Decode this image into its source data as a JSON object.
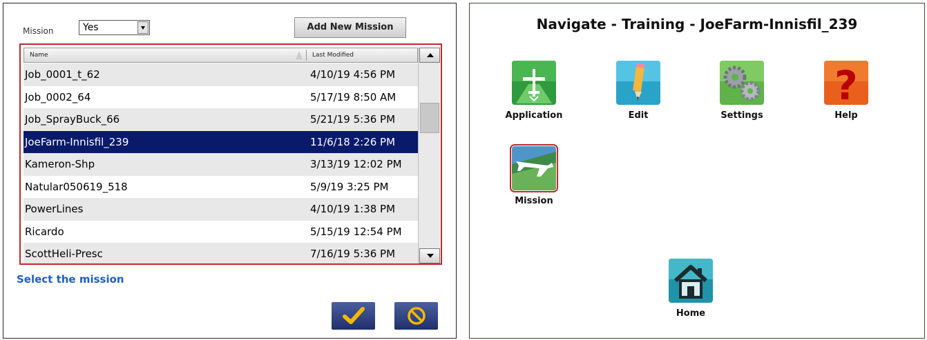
{
  "left_dialog": {
    "mission_label": "Mission",
    "mission_select_value": "Yes",
    "add_button_label": "Add New Mission",
    "columns": {
      "name": "Name",
      "last_modified": "Last Modified"
    },
    "rows": [
      {
        "name": "Job_0001_t_62",
        "date": "4/10/19 4:56 PM"
      },
      {
        "name": "Job_0002_64",
        "date": "5/17/19 8:50 AM"
      },
      {
        "name": "Job_SprayBuck_66",
        "date": "5/21/19 5:36 PM"
      },
      {
        "name": "JoeFarm-Innisfil_239",
        "date": "11/6/18 2:26 PM"
      },
      {
        "name": "Kameron-Shp",
        "date": "3/13/19 12:02 PM"
      },
      {
        "name": "Natular050619_518",
        "date": "5/9/19 3:25 PM"
      },
      {
        "name": "PowerLines",
        "date": "4/10/19 1:38 PM"
      },
      {
        "name": "Ricardo",
        "date": "5/15/19 12:54 PM"
      },
      {
        "name": "ScottHeli-Presc",
        "date": "7/16/19 5:36 PM"
      }
    ],
    "selected_row": "JoeFarm-Innisfil_239",
    "instruction": "Select the mission"
  },
  "right_panel": {
    "title": "Navigate - Training - JoeFarm-Innisfil_239",
    "tiles": {
      "application": "Application",
      "edit": "Edit",
      "settings": "Settings",
      "help": "Help",
      "mission": "Mission",
      "home": "Home"
    }
  },
  "colors": {
    "selected_row_bg": "#0a1a6b",
    "highlight_border": "#c0272d",
    "instruction_text": "#1f5fbf"
  }
}
